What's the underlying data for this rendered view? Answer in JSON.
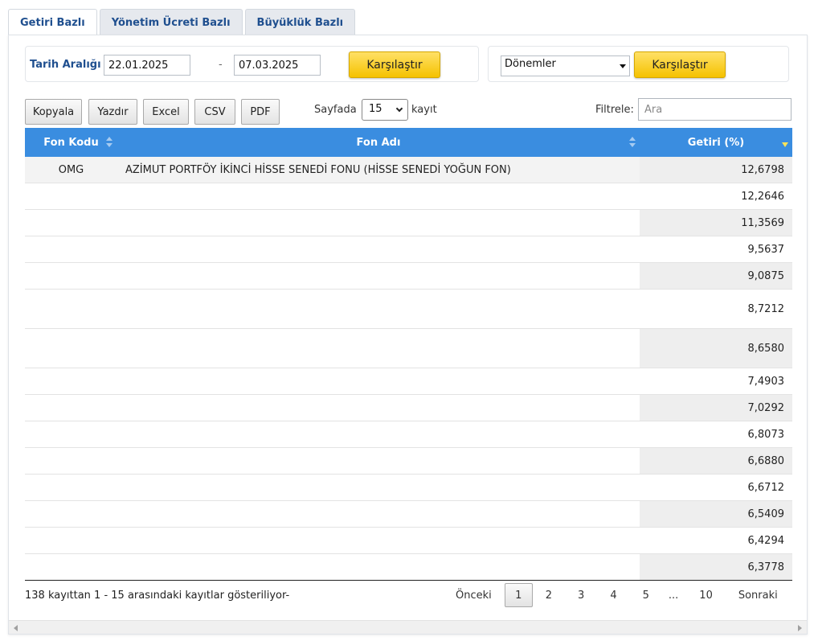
{
  "tabs": [
    {
      "label": "Getiri Bazlı",
      "active": true
    },
    {
      "label": "Yönetim Ücreti Bazlı",
      "active": false
    },
    {
      "label": "Büyüklük Bazlı",
      "active": false
    }
  ],
  "date_range": {
    "label": "Tarih Aralığı",
    "start": "22.01.2025",
    "separator": "-",
    "end": "07.03.2025",
    "compare_label": "Karşılaştır"
  },
  "period_select": {
    "value": "Dönemler",
    "compare_label": "Karşılaştır"
  },
  "toolbar": {
    "copy": "Kopyala",
    "print": "Yazdır",
    "excel": "Excel",
    "csv": "CSV",
    "pdf": "PDF",
    "page_prefix": "Sayfada",
    "page_size": "15",
    "page_suffix": "kayıt",
    "filter_label": "Filtrele:",
    "search_placeholder": "Ara"
  },
  "table": {
    "headers": {
      "code": "Fon Kodu",
      "name": "Fon Adı",
      "return": "Getiri (%)"
    },
    "rows": [
      {
        "code": "OMG",
        "name": "AZİMUT PORTFÖY İKİNCİ HİSSE SENEDİ FONU (HİSSE SENEDİ YOĞUN FON)",
        "return": "12,6798"
      },
      {
        "code": "",
        "name": "",
        "return": "12,2646"
      },
      {
        "code": "",
        "name": "",
        "return": "11,3569"
      },
      {
        "code": "",
        "name": "",
        "return": "9,5637"
      },
      {
        "code": "",
        "name": "",
        "return": "9,0875"
      },
      {
        "code": "",
        "name": "",
        "return": "8,7212"
      },
      {
        "code": "",
        "name": "",
        "return": "8,6580"
      },
      {
        "code": "",
        "name": "",
        "return": "7,4903"
      },
      {
        "code": "",
        "name": "",
        "return": "7,0292"
      },
      {
        "code": "",
        "name": "",
        "return": "6,8073"
      },
      {
        "code": "",
        "name": "",
        "return": "6,6880"
      },
      {
        "code": "",
        "name": "",
        "return": "6,6712"
      },
      {
        "code": "",
        "name": "",
        "return": "6,5409"
      },
      {
        "code": "",
        "name": "",
        "return": "6,4294"
      },
      {
        "code": "",
        "name": "",
        "return": "6,3778"
      }
    ]
  },
  "footer": {
    "info": "138 kayıttan 1 - 15 arasındaki kayıtlar gösteriliyor-",
    "prev": "Önceki",
    "pages": [
      "1",
      "2",
      "3",
      "4",
      "5",
      "...",
      "10"
    ],
    "current_page": "1",
    "next": "Sonraki"
  },
  "colors": {
    "header_bg": "#3a8de0",
    "tab_text": "#1f4f8f",
    "button_yellow": "#f5c200"
  }
}
